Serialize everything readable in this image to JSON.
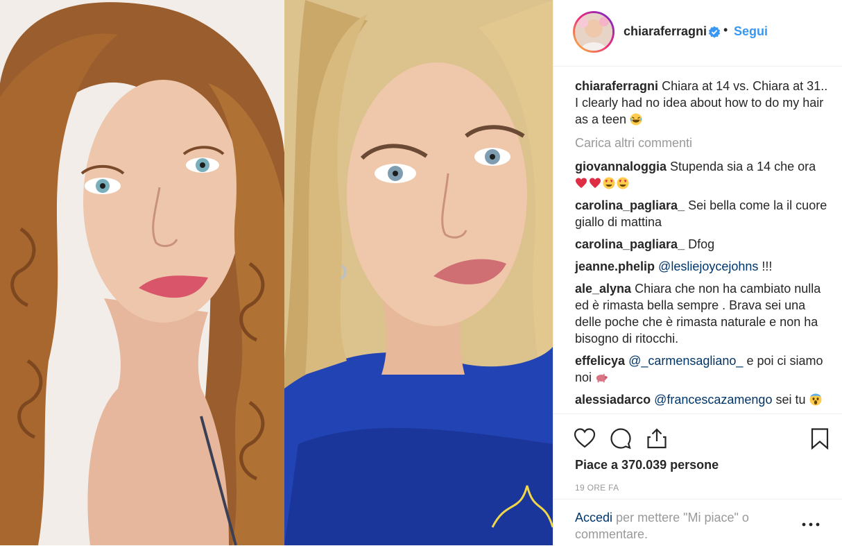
{
  "post": {
    "username": "chiaraferragni",
    "follow_label": "Segui",
    "separator": "•"
  },
  "caption": {
    "username": "chiaraferragni",
    "text": "Chiara at 14 vs. Chiara at 31.. I clearly had no idea about how to do my hair as a teen"
  },
  "load_more_label": "Carica altri commenti",
  "comments": [
    {
      "username": "giovannaloggia",
      "text": "Stupenda sia a 14 che ora"
    },
    {
      "username": "carolina_pagliara_",
      "text": "Sei bella come la il cuore giallo di mattina"
    },
    {
      "username": "carolina_pagliara_",
      "text": "Dfog"
    },
    {
      "username": "jeanne.phelip",
      "mention": "@lesliejoycejohns",
      "text": "!!!"
    },
    {
      "username": "ale_alyna",
      "text": "Chiara che non ha cambiato nulla ed è rimasta bella sempre . Brava sei una delle poche che è rimasta naturale e non ha bisogno di ritocchi."
    },
    {
      "username": "effelicya",
      "mention": "@_carmensagliano_",
      "text": "e poi ci siamo noi"
    },
    {
      "username": "alessiadarco",
      "mention": "@francescazamengo",
      "text": "sei tu"
    }
  ],
  "likes_label": "Piace a 370.039 persone",
  "timestamp": "19 ORE FA",
  "login_prompt": {
    "link": "Accedi",
    "text": "per mettere \"Mi piace\" o commentare."
  },
  "icons": {
    "like": "heart-outline-icon",
    "comment": "comment-bubble-icon",
    "share": "share-icon",
    "save": "bookmark-icon",
    "verified": "verified-badge-icon",
    "more": "more-options-icon"
  },
  "colors": {
    "link": "#3897f0",
    "text": "#262626",
    "muted": "#999999",
    "mention": "#003569"
  }
}
